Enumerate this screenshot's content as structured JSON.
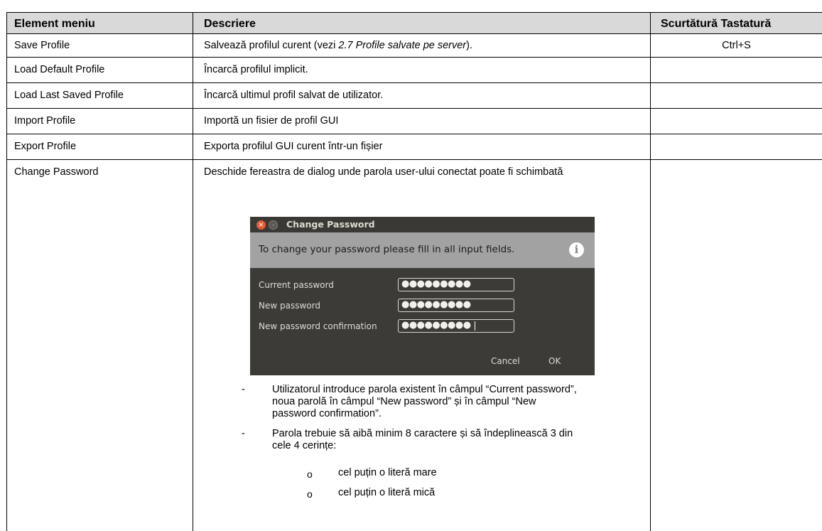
{
  "table": {
    "headers": {
      "menu_item": "Element meniu",
      "description": "Descriere",
      "shortcut": "Scurtătură Tastatură"
    },
    "rows": [
      {
        "item": "Save Profile",
        "desc_before": "Salvează profilul curent (vezi ",
        "desc_italic": "2.7 Profile salvate pe server",
        "desc_after": ").",
        "shortcut": "Ctrl+S"
      },
      {
        "item": "Load Default Profile",
        "desc": "Încarcă profilul implicit.",
        "shortcut": ""
      },
      {
        "item": "Load Last Saved Profile",
        "desc": "Încarcă ultimul profil salvat de utilizator.",
        "shortcut": ""
      },
      {
        "item": "Import Profile",
        "desc": "Importă un fisier de profil GUI",
        "shortcut": ""
      },
      {
        "item": "Export Profile",
        "desc": "Exporta profilul GUI curent într-un fișier",
        "shortcut": ""
      },
      {
        "item": "Change Password",
        "desc": "Deschide fereastra de dialog unde parola user-ului conectat poate fi schimbată",
        "shortcut": ""
      }
    ]
  },
  "dialog": {
    "title": "Change Password",
    "close_glyph": "×",
    "min_glyph": "–",
    "banner": "To change your password please fill in all input fields.",
    "info_glyph": "i",
    "fields": [
      {
        "label": "Current password",
        "value": "●●●●●●●●●"
      },
      {
        "label": "New password",
        "value": "●●●●●●●●●"
      },
      {
        "label": "New password confirmation",
        "value": "●●●●●●●●●"
      }
    ],
    "cancel": "Cancel",
    "ok": "OK"
  },
  "bullets": {
    "dash": "-",
    "circle": "o",
    "item1": [
      "Utilizatorul introduce parola existent în câmpul “Current password”,",
      "noua parolă în câmpul “New password” și în câmpul  “New",
      "password confirmation”."
    ],
    "item2": [
      "Parola trebuie să aibă minim 8 caractere și să îndeplinească 3 din",
      "cele 4 cerințe:"
    ],
    "sub": [
      "cel puțin o literă mare",
      "cel puțin o literă mică"
    ]
  }
}
